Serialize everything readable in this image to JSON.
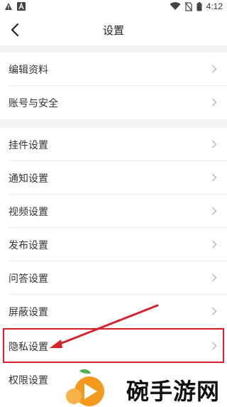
{
  "status_bar": {
    "time": "4:12",
    "left_icons": [
      "warning-icon",
      "a-icon"
    ],
    "right_icons": [
      "wifi-icon",
      "no-sim-icon",
      "battery-icon"
    ]
  },
  "header": {
    "title": "设置",
    "back_icon": "chevron-left-icon"
  },
  "settings": {
    "group1": [
      {
        "label": "编辑资料"
      },
      {
        "label": "账号与安全"
      }
    ],
    "group2": [
      {
        "label": "挂件设置"
      },
      {
        "label": "通知设置"
      },
      {
        "label": "视频设置"
      },
      {
        "label": "发布设置"
      },
      {
        "label": "问答设置"
      },
      {
        "label": "屏蔽设置"
      },
      {
        "label": "隐私设置"
      },
      {
        "label": "权限设置"
      }
    ]
  },
  "annotation": {
    "highlight_color": "#d8222a",
    "highlighted_item": "隐私设置"
  },
  "watermark": {
    "text": "碗手游网",
    "logo_colors": [
      "#f39a1e",
      "#4caf50"
    ]
  }
}
